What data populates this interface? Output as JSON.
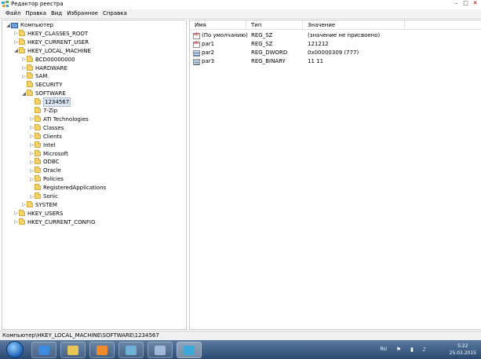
{
  "window": {
    "title": "Редактор реестра"
  },
  "menu": [
    "Файл",
    "Правка",
    "Вид",
    "Избранное",
    "Справка"
  ],
  "tree": [
    {
      "label": "Компьютер",
      "depth": 0,
      "arrow": "◢",
      "icon": "computer-icon"
    },
    {
      "label": "HKEY_CLASSES_ROOT",
      "depth": 1,
      "arrow": "▷"
    },
    {
      "label": "HKEY_CURRENT_USER",
      "depth": 1,
      "arrow": "▷"
    },
    {
      "label": "HKEY_LOCAL_MACHINE",
      "depth": 1,
      "arrow": "◢"
    },
    {
      "label": "BCD00000000",
      "depth": 2,
      "arrow": "▷"
    },
    {
      "label": "HARDWARE",
      "depth": 2,
      "arrow": "▷"
    },
    {
      "label": "SAM",
      "depth": 2,
      "arrow": "▷"
    },
    {
      "label": "SECURITY",
      "depth": 2,
      "arrow": ""
    },
    {
      "label": "SOFTWARE",
      "depth": 2,
      "arrow": "◢"
    },
    {
      "label": "1234567",
      "depth": 3,
      "arrow": "",
      "selected": true
    },
    {
      "label": "7-Zip",
      "depth": 3,
      "arrow": ""
    },
    {
      "label": "ATI Technologies",
      "depth": 3,
      "arrow": "▷"
    },
    {
      "label": "Classes",
      "depth": 3,
      "arrow": "▷"
    },
    {
      "label": "Clients",
      "depth": 3,
      "arrow": "▷"
    },
    {
      "label": "Intel",
      "depth": 3,
      "arrow": "▷"
    },
    {
      "label": "Microsoft",
      "depth": 3,
      "arrow": "▷"
    },
    {
      "label": "ODBC",
      "depth": 3,
      "arrow": "▷"
    },
    {
      "label": "Oracle",
      "depth": 3,
      "arrow": "▷"
    },
    {
      "label": "Policies",
      "depth": 3,
      "arrow": "▷"
    },
    {
      "label": "RegisteredApplications",
      "depth": 3,
      "arrow": ""
    },
    {
      "label": "Sonic",
      "depth": 3,
      "arrow": "▷"
    },
    {
      "label": "SYSTEM",
      "depth": 2,
      "arrow": "▷"
    },
    {
      "label": "HKEY_USERS",
      "depth": 1,
      "arrow": "▷"
    },
    {
      "label": "HKEY_CURRENT_CONFIG",
      "depth": 1,
      "arrow": "▷"
    }
  ],
  "list": {
    "columns": [
      "Имя",
      "Тип",
      "Значение"
    ],
    "rows": [
      {
        "name": "(По умолчанию)",
        "type": "REG_SZ",
        "value": "(значение не присвоено)",
        "icon": "sz"
      },
      {
        "name": "par1",
        "type": "REG_SZ",
        "value": "121212",
        "icon": "sz"
      },
      {
        "name": "par2",
        "type": "REG_DWORD",
        "value": "0x00000309 (777)",
        "icon": "bin"
      },
      {
        "name": "par3",
        "type": "REG_BINARY",
        "value": "11 11",
        "icon": "bin"
      }
    ]
  },
  "status": {
    "path": "Компьютер\\HKEY_LOCAL_MACHINE\\SOFTWARE\\1234567"
  },
  "taskbar": {
    "lang": "RU",
    "time": "5:22",
    "date": "25.03.2015",
    "buttons": [
      {
        "name": "ie-icon",
        "color": "#3d8be0"
      },
      {
        "name": "explorer-icon",
        "color": "#e8c658"
      },
      {
        "name": "media-player-icon",
        "color": "#f08a2a"
      },
      {
        "name": "app-icon",
        "color": "#6fb0d6"
      },
      {
        "name": "window-icon",
        "color": "#9fb8d8"
      },
      {
        "name": "regedit-icon",
        "color": "#3aa8d8",
        "active": true
      }
    ]
  }
}
